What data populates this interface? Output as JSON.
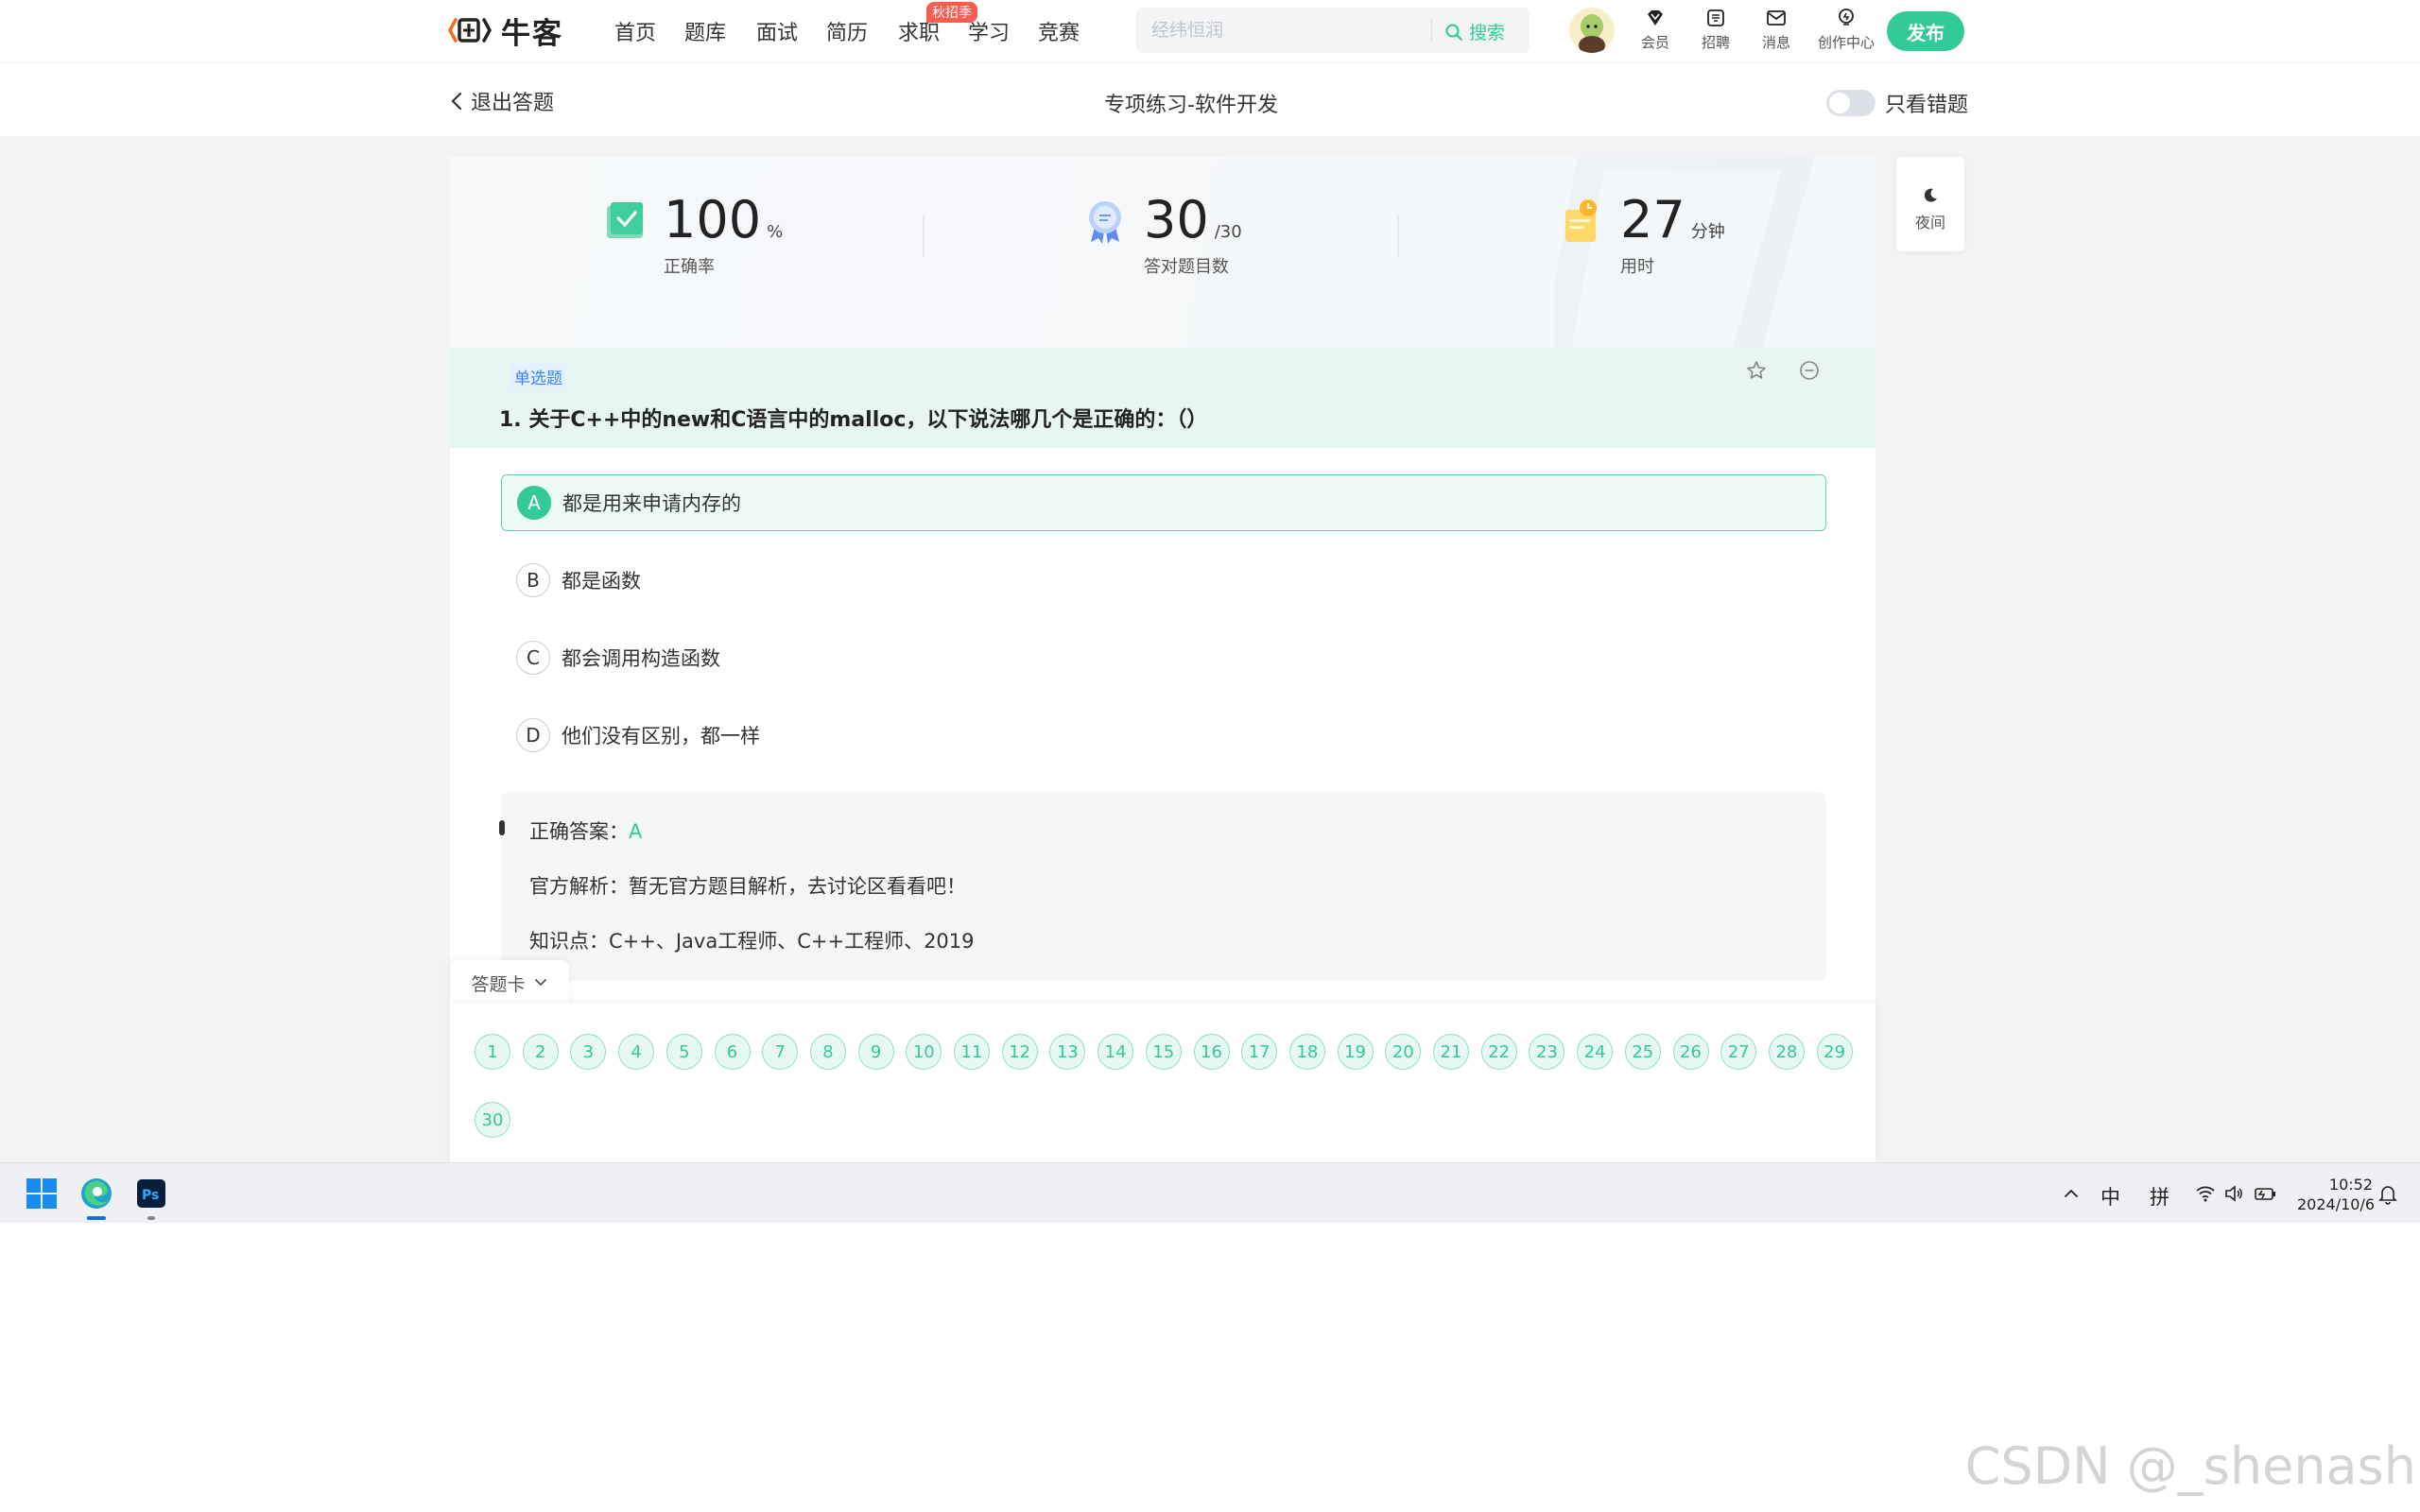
{
  "nav": {
    "logo_text": "牛客",
    "items": [
      "首页",
      "题库",
      "面试",
      "简历",
      "求职",
      "学习",
      "竞赛"
    ],
    "hot_badge": "秋招季",
    "search_placeholder": "经纬恒润",
    "search_button": "搜索",
    "tools": [
      "会员",
      "招聘",
      "消息",
      "创作中心"
    ],
    "publish": "发布"
  },
  "subbar": {
    "back": "退出答题",
    "title": "专项练习-软件开发",
    "toggle_label": "只看错题"
  },
  "stats": [
    {
      "value": "100",
      "unit": "%",
      "label": "正确率"
    },
    {
      "value": "30",
      "unit": "/30",
      "label": "答对题目数"
    },
    {
      "value": "27",
      "unit": "分钟",
      "label": "用时"
    }
  ],
  "question": {
    "type": "单选题",
    "text": "1. 关于C++中的new和C语言中的malloc，以下说法哪几个是正确的：（）",
    "options": [
      {
        "letter": "A",
        "text": "都是用来申请内存的",
        "correct": true
      },
      {
        "letter": "B",
        "text": "都是函数"
      },
      {
        "letter": "C",
        "text": "都会调用构造函数"
      },
      {
        "letter": "D",
        "text": "他们没有区别，都一样"
      }
    ]
  },
  "analysis": {
    "answer_label": "正确答案：",
    "answer_value": "A",
    "official": "官方解析：暂无官方题目解析，去讨论区看看吧！",
    "knowledge": "知识点：C++、Java工程师、C++工程师、2019"
  },
  "answer_card": {
    "tab": "答题卡",
    "numbers": [
      "1",
      "2",
      "3",
      "4",
      "5",
      "6",
      "7",
      "8",
      "9",
      "10",
      "11",
      "12",
      "13",
      "14",
      "15",
      "16",
      "17",
      "18",
      "19",
      "20",
      "21",
      "22",
      "23",
      "24",
      "25",
      "26",
      "27",
      "28",
      "29",
      "30"
    ]
  },
  "side": {
    "night": "夜间"
  },
  "taskbar": {
    "tray_ime": "中",
    "tray_pinyin": "拼",
    "time": "10:52",
    "date": "2024/10/6"
  },
  "watermark": "CSDN @_shenash",
  "colors": {
    "accent": "#32ca99",
    "hot": "#fa5c4f",
    "tag_blue": "#3a85f0"
  }
}
